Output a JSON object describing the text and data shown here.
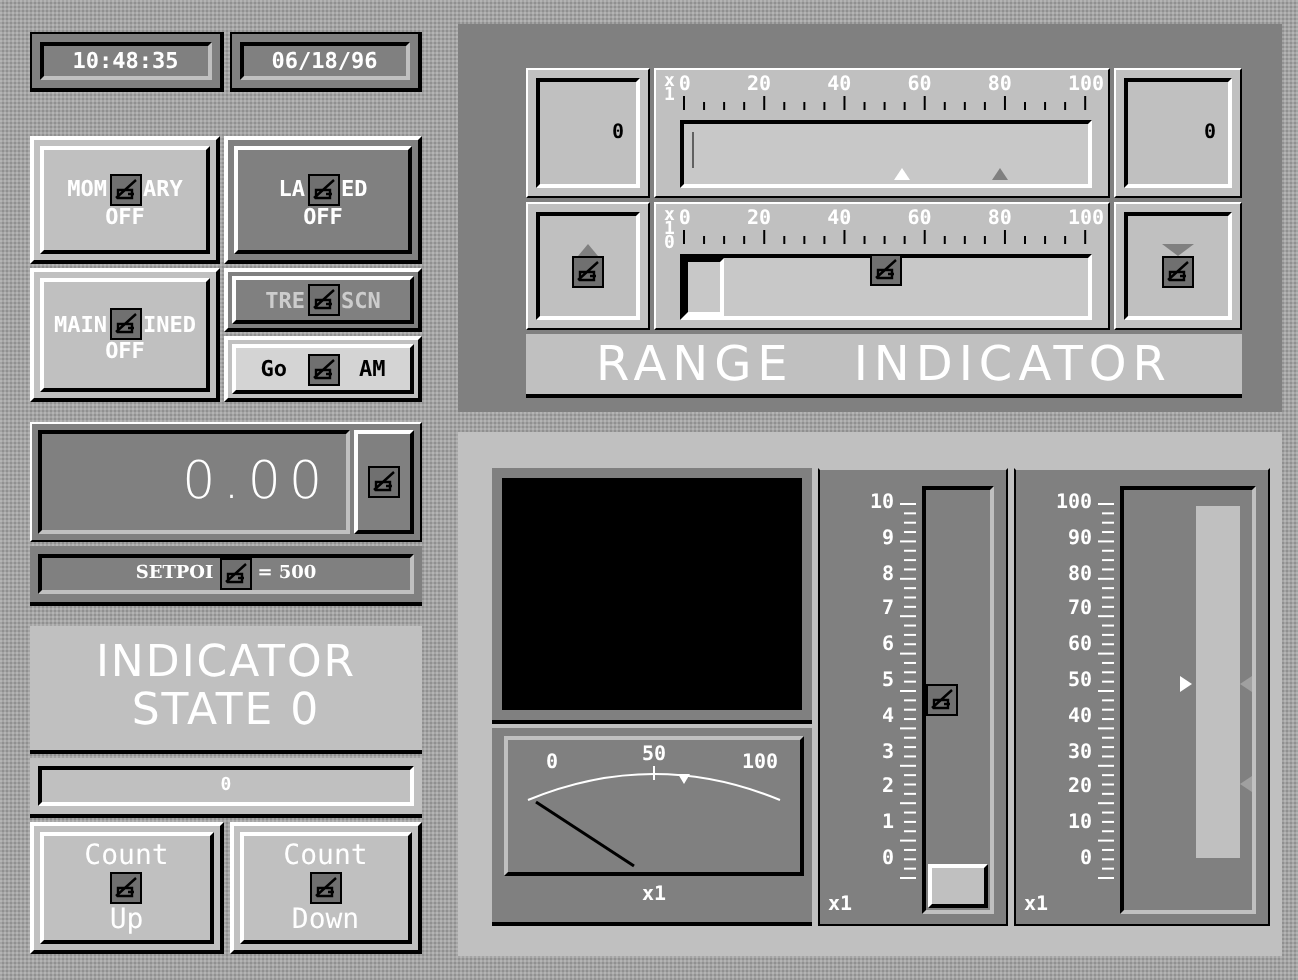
{
  "clock": {
    "time": "10:48:35",
    "date": "06/18/96"
  },
  "pushbuttons": [
    {
      "kind": "momentary",
      "label": [
        "MOM",
        "ARY"
      ],
      "status": "OFF"
    },
    {
      "kind": "latched",
      "label": [
        "LA",
        "ED"
      ],
      "status": "OFF"
    },
    {
      "kind": "maintained",
      "label": [
        "MAIN",
        "INED"
      ],
      "status": "OFF"
    }
  ],
  "trend_button": {
    "label": [
      "TRE",
      "SCN"
    ],
    "disabled": true
  },
  "mode_switch": {
    "label": [
      "Go",
      "AM"
    ],
    "on": true
  },
  "value_display": {
    "value": "0.00"
  },
  "setpoint": {
    "label": [
      "SETPOI",
      "= 500"
    ]
  },
  "indicator": {
    "lines": [
      "INDICATOR",
      "STATE 0"
    ]
  },
  "counter": {
    "value": "0"
  },
  "count_buttons": [
    {
      "label": "Count",
      "sublabel": "Up"
    },
    {
      "label": "Count",
      "sublabel": "Down"
    }
  ],
  "range_indicator": {
    "title": "RANGE INDICATOR",
    "rows": [
      {
        "kind": "display",
        "left_value": "0",
        "right_value": "0",
        "multiplier": "x1",
        "ticks": [
          "0",
          "20",
          "40",
          "60",
          "80",
          "100"
        ],
        "level": 0.02
      },
      {
        "kind": "slider",
        "multiplier": "x10",
        "ticks": [
          "0",
          "20",
          "40",
          "60",
          "80",
          "100"
        ],
        "level": 0.5
      }
    ]
  },
  "gauge": {
    "ticks": [
      "0",
      "50",
      "100"
    ],
    "multiplier": "x1"
  },
  "vertical_slider": {
    "ticks": [
      "10",
      "9",
      "8",
      "7",
      "6",
      "5",
      "4",
      "3",
      "2",
      "1",
      "0"
    ],
    "multiplier": "x1",
    "level": 0.5
  },
  "bar_graph": {
    "ticks": [
      "100",
      "90",
      "80",
      "70",
      "60",
      "50",
      "40",
      "30",
      "20",
      "10",
      "0"
    ],
    "multiplier": "x1"
  }
}
